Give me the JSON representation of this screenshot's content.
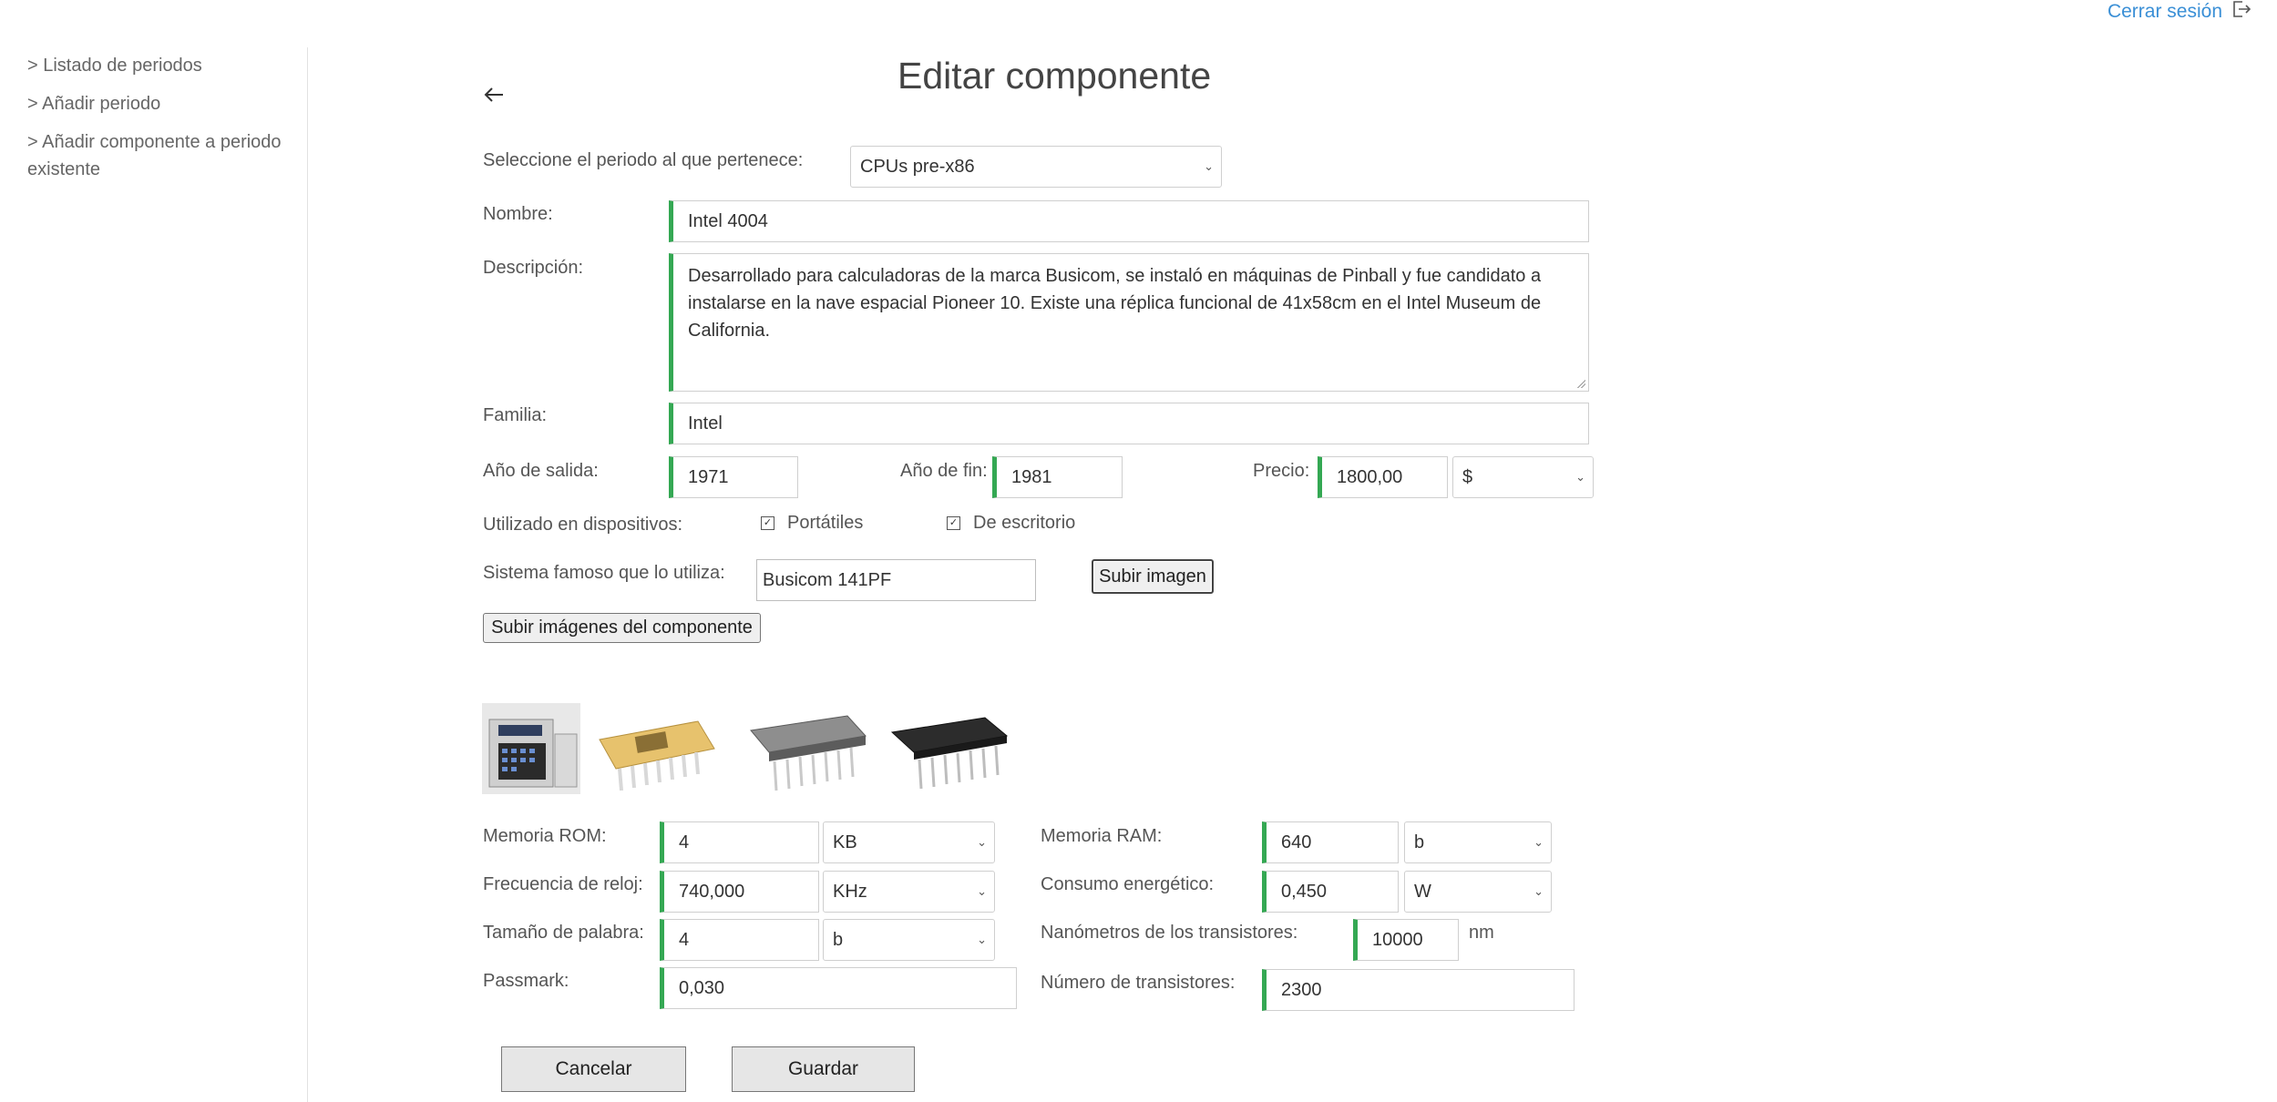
{
  "header": {
    "logout_label": "Cerrar sesión",
    "logout_icon": "logout-icon"
  },
  "sidebar": {
    "items": [
      {
        "label": "> Listado de periodos"
      },
      {
        "label": "> Añadir periodo"
      },
      {
        "label": "> Añadir componente a periodo existente"
      }
    ]
  },
  "page": {
    "title": "Editar componente",
    "back_icon": "arrow-left-icon"
  },
  "form": {
    "period_label": "Seleccione el periodo al que pertenece:",
    "period_value": "CPUs pre-x86",
    "name_label": "Nombre:",
    "name_value": "Intel 4004",
    "description_label": "Descripción:",
    "description_value": "Desarrollado para calculadoras de la marca Busicom, se instaló en máquinas de Pinball y fue candidato a instalarse en la nave espacial Pioneer 10. Existe una réplica funcional de 41x58cm en el Intel Museum de California.",
    "family_label": "Familia:",
    "family_value": "Intel",
    "release_year_label": "Año de salida:",
    "release_year_value": "1971",
    "end_year_label": "Año de fin:",
    "end_year_value": "1981",
    "price_label": "Precio:",
    "price_value": "1800,00",
    "currency_value": "$",
    "devices_label": "Utilizado en dispositivos:",
    "devices": [
      {
        "label": "Portátiles",
        "checked": true
      },
      {
        "label": "De escritorio",
        "checked": true
      }
    ],
    "famous_system_label": "Sistema famoso que lo utiliza:",
    "famous_system_value": "Busicom 141PF",
    "upload_image_label": "Subir imagen",
    "upload_component_images_label": "Subir imágenes del componente",
    "rom_label": "Memoria ROM:",
    "rom_value": "4",
    "rom_unit": "KB",
    "ram_label": "Memoria RAM:",
    "ram_value": "640",
    "ram_unit": "b",
    "clock_label": "Frecuencia de reloj:",
    "clock_value": "740,000",
    "clock_unit": "KHz",
    "power_label": "Consumo energético:",
    "power_value": "0,450",
    "power_unit": "W",
    "word_label": "Tamaño de palabra:",
    "word_value": "4",
    "word_unit": "b",
    "nm_label": "Nanómetros de los transistores:",
    "nm_value": "10000",
    "nm_unit": "nm",
    "passmark_label": "Passmark:",
    "passmark_value": "0,030",
    "transistors_label": "Número de transistores:",
    "transistors_value": "2300",
    "cancel_label": "Cancelar",
    "save_label": "Guardar"
  },
  "colors": {
    "accent_green": "#34a853",
    "link_blue": "#3a8fd6"
  }
}
